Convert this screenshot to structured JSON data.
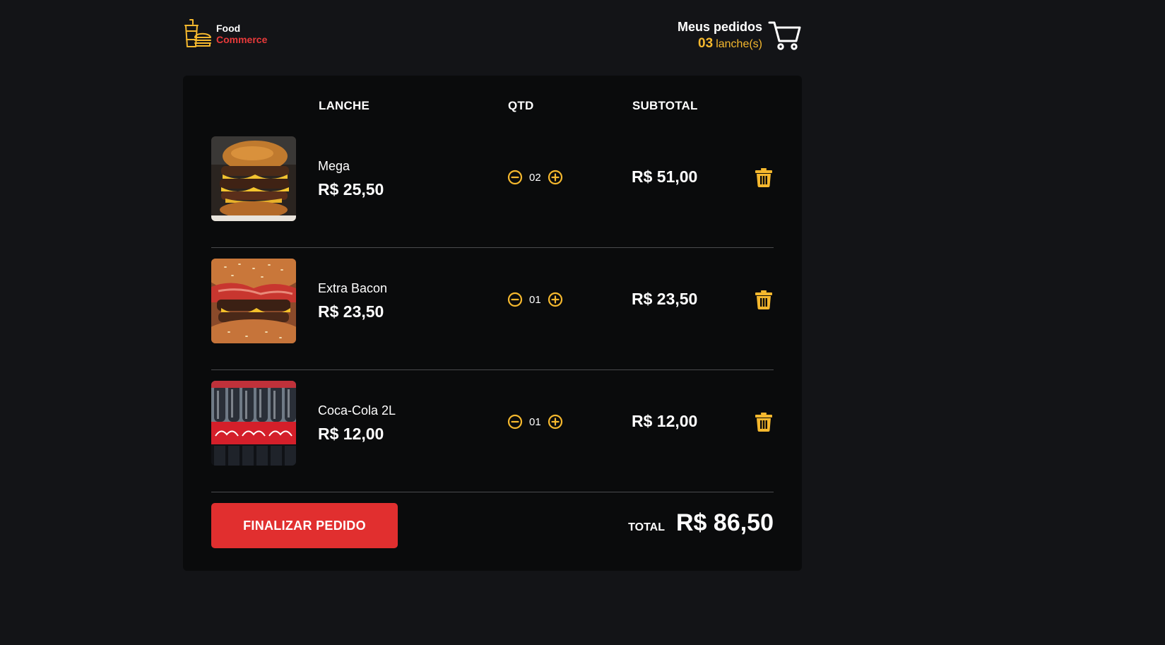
{
  "header": {
    "logo": {
      "line1": "Food",
      "line2": "Commerce",
      "icon": "fast-food-icon"
    },
    "orders": {
      "title": "Meus pedidos",
      "count": "03",
      "unit": "lanche(s)",
      "icon": "cart-icon"
    }
  },
  "table": {
    "columns": {
      "item": "LANCHE",
      "qty": "QTD",
      "subtotal": "SUBTOTAL"
    },
    "rows": [
      {
        "name": "Mega",
        "price": "R$ 25,50",
        "qty": "02",
        "subtotal": "R$ 51,00",
        "image": "burger-photo"
      },
      {
        "name": "Extra Bacon",
        "price": "R$ 23,50",
        "qty": "01",
        "subtotal": "R$ 23,50",
        "image": "bacon-burger-photo"
      },
      {
        "name": "Coca-Cola 2L",
        "price": "R$ 12,00",
        "qty": "01",
        "subtotal": "R$ 12,00",
        "image": "coca-cola-bottles-photo"
      }
    ]
  },
  "footer": {
    "finalize_label": "FINALIZAR PEDIDO",
    "total_label": "TOTAL",
    "total_value": "R$ 86,50"
  },
  "colors": {
    "background": "#131417",
    "card": "#0a0b0c",
    "accent": "#f5b82e",
    "brand_red": "#e12f2f"
  }
}
